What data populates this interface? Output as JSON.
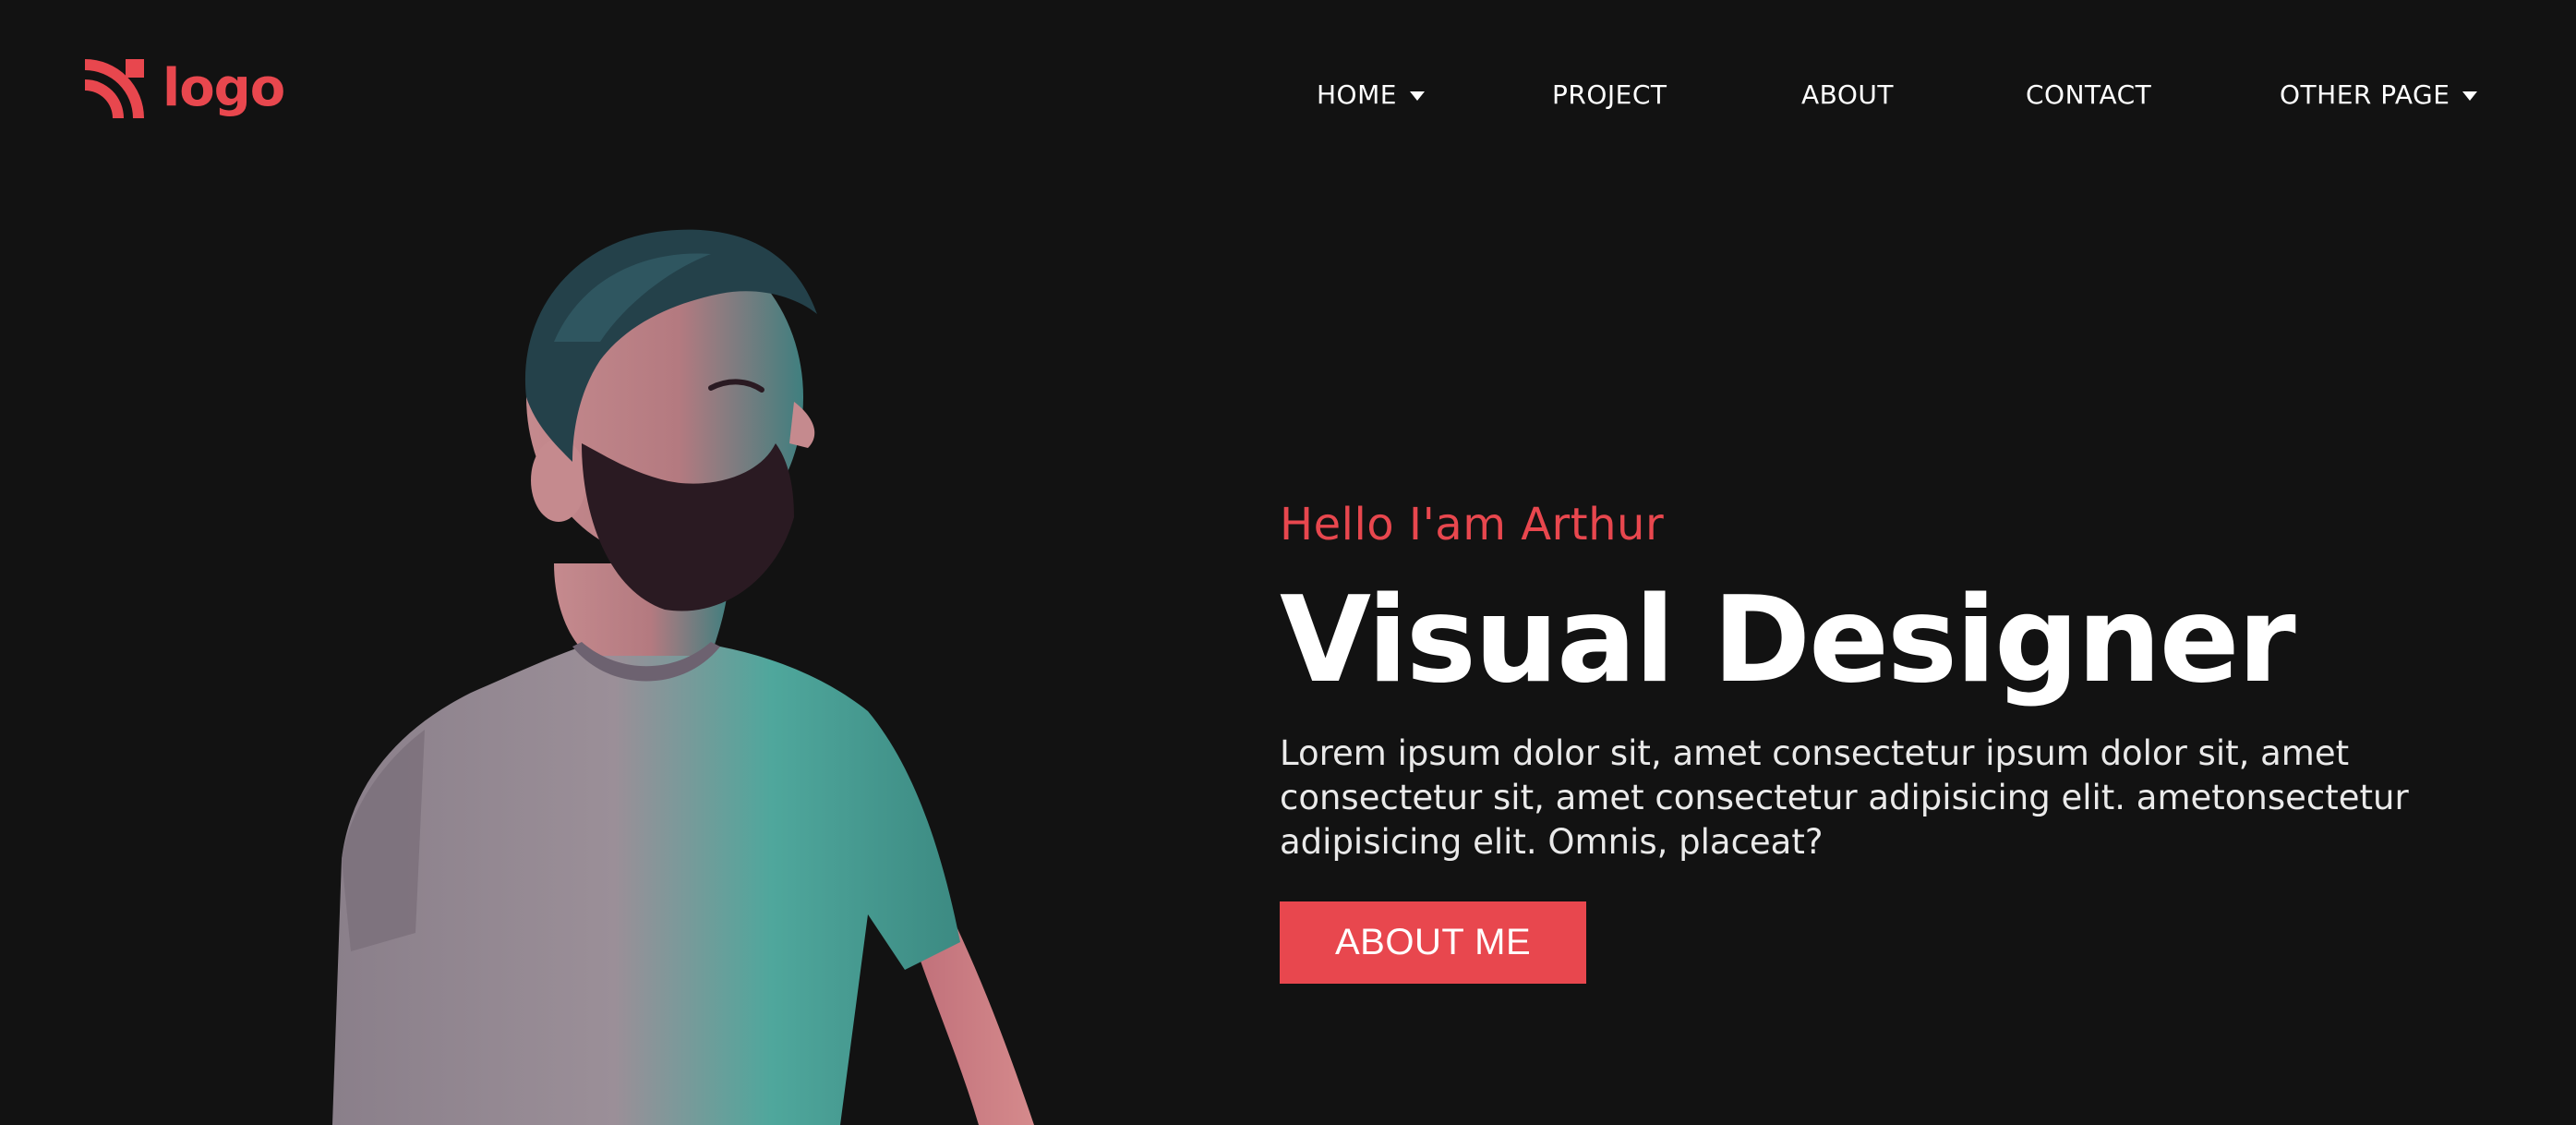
{
  "brand": {
    "logo_text": "logo",
    "accent_color": "#e8474e"
  },
  "nav": {
    "items": [
      {
        "label": "HOME",
        "has_dropdown": true
      },
      {
        "label": "PROJECT",
        "has_dropdown": false
      },
      {
        "label": "ABOUT",
        "has_dropdown": false
      },
      {
        "label": "CONTACT",
        "has_dropdown": false
      },
      {
        "label": "OTHER PAGE",
        "has_dropdown": true
      }
    ]
  },
  "hero": {
    "greeting": "Hello I'am Arthur",
    "headline": "Visual Designer",
    "description": "Lorem ipsum dolor sit, amet consectetur ipsum dolor sit, amet consectetur sit, amet consectetur adipisicing elit. ametonsectetur adipisicing elit. Omnis, placeat?",
    "cta_label": "ABOUT ME"
  },
  "colors": {
    "background": "#121212",
    "text": "#ffffff",
    "accent": "#e8474e"
  },
  "icons": {
    "logo": "wifi-rss-logo-icon",
    "dropdown": "caret-down-icon"
  }
}
